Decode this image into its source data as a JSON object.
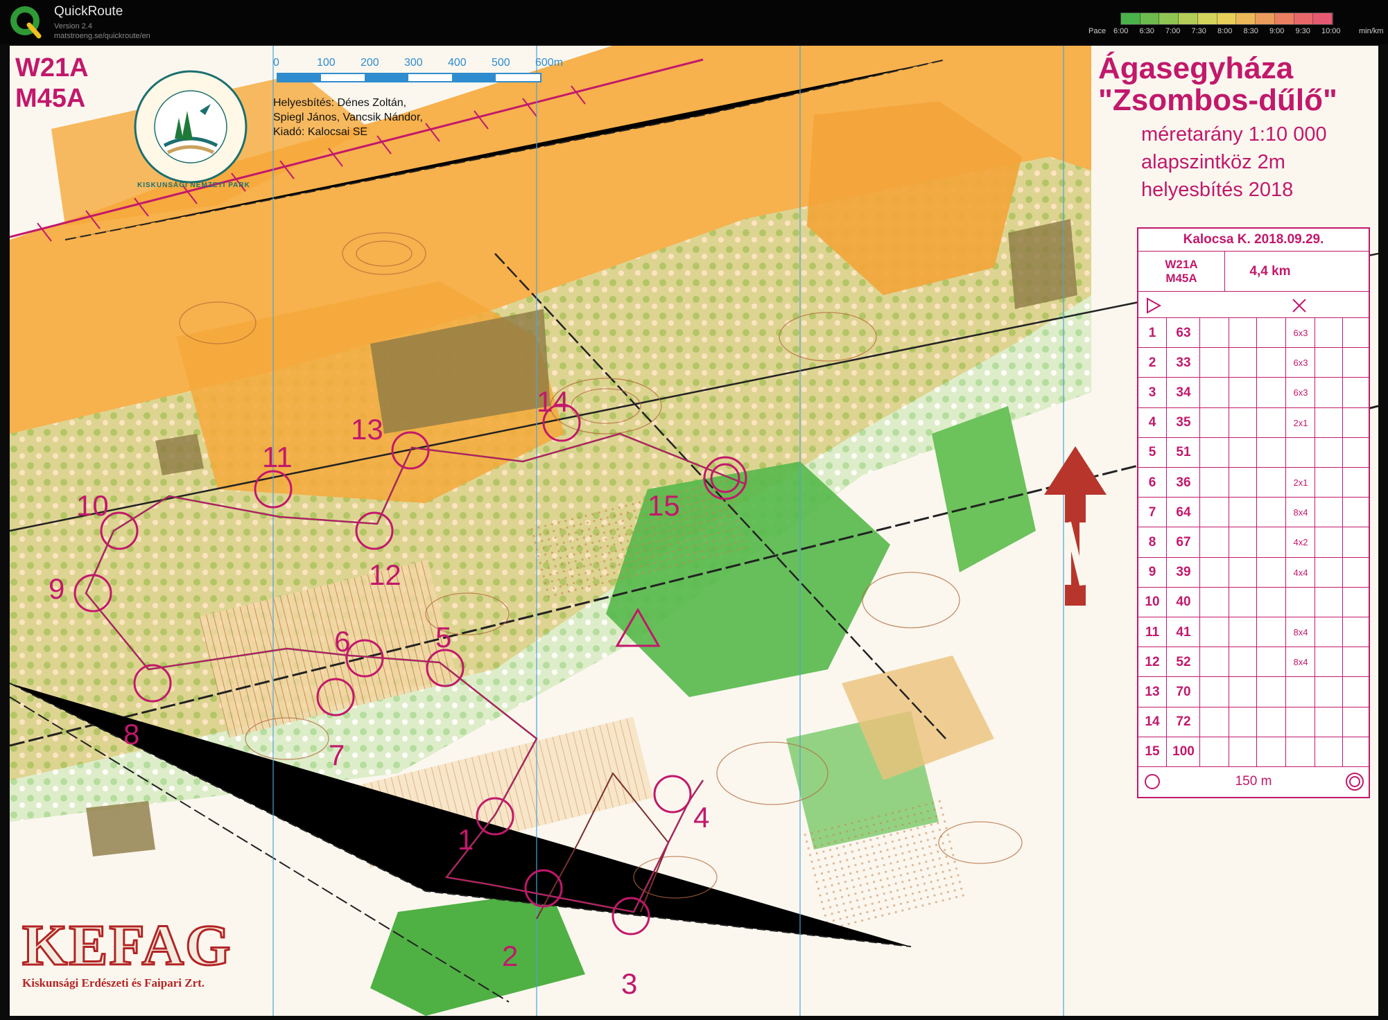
{
  "app": {
    "name": "QuickRoute",
    "version": "Version 2.4",
    "url": "matstroeng.se/quickroute/en"
  },
  "pace_scale": {
    "label": "Pace",
    "ticks": [
      "6:00",
      "6:30",
      "7:00",
      "7:30",
      "8:00",
      "8:30",
      "9:00",
      "9:30",
      "10:00"
    ],
    "unit": "min/km",
    "colors": [
      "#49b34a",
      "#6dbb4c",
      "#8fc552",
      "#b3cd58",
      "#d4d45c",
      "#e8cf5a",
      "#ecb85a",
      "#eb9c5c",
      "#ea7f62",
      "#e8686a",
      "#e55a72"
    ]
  },
  "map": {
    "classes": [
      "W21A",
      "M45A"
    ],
    "park_name": "KISKUNSÁGI NEMZETI PARK",
    "scale_ticks": [
      "0",
      "100",
      "200",
      "300",
      "400",
      "500",
      "600m"
    ],
    "credits": [
      "Helyesbítés: Dénes Zoltán,",
      "Spiegl János, Vancsik Nándor,",
      "Kiadó: Kalocsai SE"
    ],
    "place": "Ágasegyháza",
    "area": "\"Zsombos-dűlő\"",
    "info": [
      "méretarány  1:10 000",
      "alapszintköz  2m",
      "helyesbítés  2018"
    ],
    "sponsor": "KEFAG",
    "sponsor_full": "Kiskunsági Erdészeti és Faipari Zrt.",
    "control_labels": [
      "1",
      "2",
      "3",
      "4",
      "5",
      "6",
      "7",
      "8",
      "9",
      "10",
      "11",
      "12",
      "13",
      "14",
      "15"
    ]
  },
  "description_sheet": {
    "event": "Kalocsa K. 2018.09.29.",
    "classes": "W21A\nM45A",
    "length": "4,4 km",
    "controls": [
      {
        "n": "1",
        "code": "63",
        "dim": "6x3"
      },
      {
        "n": "2",
        "code": "33",
        "dim": "6x3"
      },
      {
        "n": "3",
        "code": "34",
        "dim": "6x3"
      },
      {
        "n": "4",
        "code": "35",
        "dim": "2x1"
      },
      {
        "n": "5",
        "code": "51",
        "dim": ""
      },
      {
        "n": "6",
        "code": "36",
        "dim": "2x1"
      },
      {
        "n": "7",
        "code": "64",
        "dim": "8x4"
      },
      {
        "n": "8",
        "code": "67",
        "dim": "4x2"
      },
      {
        "n": "9",
        "code": "39",
        "dim": "4x4"
      },
      {
        "n": "10",
        "code": "40",
        "dim": ""
      },
      {
        "n": "11",
        "code": "41",
        "dim": "8x4"
      },
      {
        "n": "12",
        "code": "52",
        "dim": "8x4"
      },
      {
        "n": "13",
        "code": "70",
        "dim": ""
      },
      {
        "n": "14",
        "code": "72",
        "dim": ""
      },
      {
        "n": "15",
        "code": "100",
        "dim": ""
      }
    ],
    "finish_text": "150 m"
  }
}
